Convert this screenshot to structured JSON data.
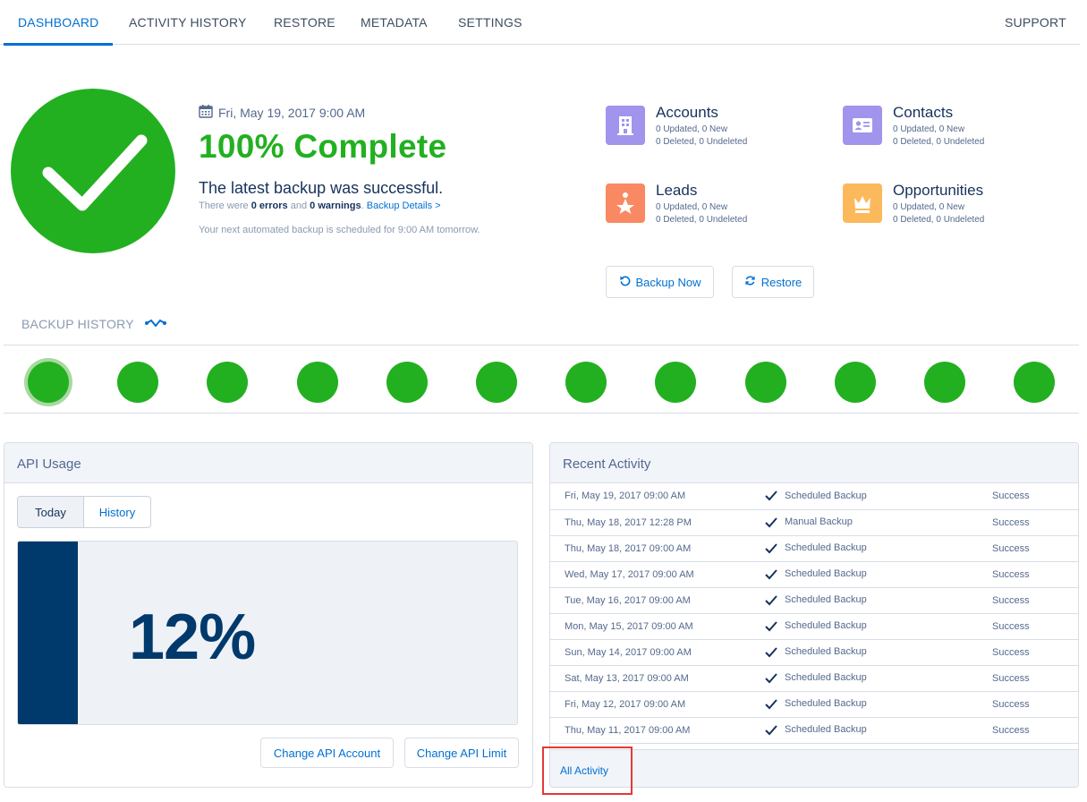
{
  "nav": {
    "tabs": [
      "DASHBOARD",
      "ACTIVITY HISTORY",
      "RESTORE",
      "METADATA",
      "SETTINGS"
    ],
    "active": "DASHBOARD",
    "support": "SUPPORT"
  },
  "status": {
    "date": "Fri, May 19, 2017 9:00 AM",
    "title": "100% Complete",
    "subtitle": "The latest backup was successful.",
    "detail_prefix": "There were ",
    "errors": "0 errors",
    "detail_and": " and ",
    "warnings": "0 warnings",
    "detail_suffix": ". ",
    "details_link": "Backup Details >",
    "next": "Your next automated backup is scheduled for 9:00 AM tomorrow.",
    "color": "#22b020"
  },
  "objects": [
    {
      "name": "Accounts",
      "line1": "0 Updated, 0 New",
      "line2": "0 Deleted, 0 Undeleted",
      "color": "#a094ed",
      "icon": "building-icon"
    },
    {
      "name": "Contacts",
      "line1": "0 Updated, 0 New",
      "line2": "0 Deleted, 0 Undeleted",
      "color": "#a094ed",
      "icon": "contact-card-icon"
    },
    {
      "name": "Leads",
      "line1": "0 Updated, 0 New",
      "line2": "0 Deleted, 0 Undeleted",
      "color": "#f88962",
      "icon": "lead-star-icon"
    },
    {
      "name": "Opportunities",
      "line1": "0 Updated, 0 New",
      "line2": "0 Deleted, 0 Undeleted",
      "color": "#fcb95b",
      "icon": "crown-icon"
    }
  ],
  "actions": {
    "backup_now": "Backup Now",
    "restore": "Restore"
  },
  "backup_history": {
    "label": "BACKUP HISTORY",
    "count": 12,
    "selected_index": 0,
    "status": "success"
  },
  "api_usage": {
    "title": "API Usage",
    "tabs": [
      "Today",
      "History"
    ],
    "active_tab": "Today",
    "percent_label": "12%",
    "percent": 12,
    "change_account": "Change API Account",
    "change_limit": "Change API Limit",
    "color": "#00396b"
  },
  "recent_activity": {
    "title": "Recent Activity",
    "rows": [
      {
        "date": "Fri, May 19, 2017 09:00 AM",
        "type": "Scheduled Backup",
        "status": "Success"
      },
      {
        "date": "Thu, May 18, 2017 12:28 PM",
        "type": "Manual Backup",
        "status": "Success"
      },
      {
        "date": "Thu, May 18, 2017 09:00 AM",
        "type": "Scheduled Backup",
        "status": "Success"
      },
      {
        "date": "Wed, May 17, 2017 09:00 AM",
        "type": "Scheduled Backup",
        "status": "Success"
      },
      {
        "date": "Tue, May 16, 2017 09:00 AM",
        "type": "Scheduled Backup",
        "status": "Success"
      },
      {
        "date": "Mon, May 15, 2017 09:00 AM",
        "type": "Scheduled Backup",
        "status": "Success"
      },
      {
        "date": "Sun, May 14, 2017 09:00 AM",
        "type": "Scheduled Backup",
        "status": "Success"
      },
      {
        "date": "Sat, May 13, 2017 09:00 AM",
        "type": "Scheduled Backup",
        "status": "Success"
      },
      {
        "date": "Fri, May 12, 2017 09:00 AM",
        "type": "Scheduled Backup",
        "status": "Success"
      },
      {
        "date": "Thu, May 11, 2017 09:00 AM",
        "type": "Scheduled Backup",
        "status": "Success"
      }
    ],
    "all_activity": "All Activity",
    "highlight_color": "#e53935"
  }
}
